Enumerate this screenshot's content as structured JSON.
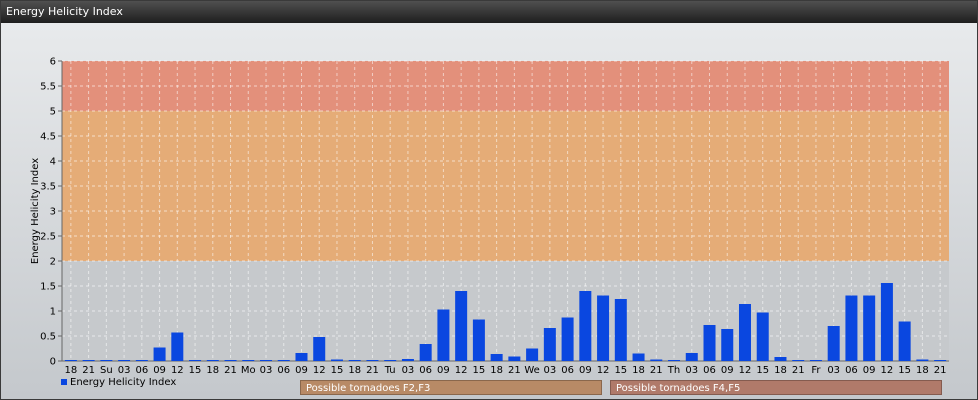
{
  "window": {
    "title": "Energy Helicity Index"
  },
  "legend": {
    "label": "Energy Helicity Index"
  },
  "zones": {
    "f2f3": "Possible tornadoes F2,F3",
    "f4f5": "Possible tornadoes F4,F5"
  },
  "colors": {
    "bar": "#0a47e0",
    "band_high": "#e58a72",
    "band_mid": "#e8a86e",
    "band_low": "#c6c9cc"
  },
  "chart_data": {
    "type": "bar",
    "ylabel": "Energy Helicity Index",
    "xlabel": "",
    "ylim": [
      0,
      6
    ],
    "yticks": [
      "0",
      "0.5",
      "1",
      "1.5",
      "2",
      "2.5",
      "3",
      "3.5",
      "4",
      "4.5",
      "5",
      "5.5",
      "6"
    ],
    "bands": [
      {
        "from": 2,
        "to": 5,
        "color": "#e8a86e"
      },
      {
        "from": 5,
        "to": 6,
        "color": "#e58a72"
      }
    ],
    "categories": [
      "18",
      "21",
      "Su",
      "03",
      "06",
      "09",
      "12",
      "15",
      "18",
      "21",
      "Mo",
      "03",
      "06",
      "09",
      "12",
      "15",
      "18",
      "21",
      "Tu",
      "03",
      "06",
      "09",
      "12",
      "15",
      "18",
      "21",
      "We",
      "03",
      "06",
      "09",
      "12",
      "15",
      "18",
      "21",
      "Th",
      "03",
      "06",
      "09",
      "12",
      "15",
      "18",
      "21",
      "Fr",
      "03",
      "06",
      "09",
      "12",
      "15",
      "18",
      "21"
    ],
    "series": [
      {
        "name": "Energy Helicity Index",
        "values": [
          0.02,
          0.02,
          0.02,
          0.02,
          0.02,
          0.27,
          0.57,
          0.02,
          0.02,
          0.02,
          0.02,
          0.02,
          0.02,
          0.16,
          0.48,
          0.03,
          0.02,
          0.02,
          0.02,
          0.04,
          0.34,
          1.03,
          1.4,
          0.83,
          0.14,
          0.09,
          0.25,
          0.66,
          0.87,
          1.4,
          1.31,
          1.24,
          0.15,
          0.03,
          0.02,
          0.16,
          0.72,
          0.64,
          1.14,
          0.97,
          0.08,
          0.02,
          0.02,
          0.7,
          1.31,
          1.31,
          1.56,
          0.79,
          0.03,
          0.02
        ]
      }
    ],
    "grid": true,
    "legend_position": "bottom-left"
  }
}
